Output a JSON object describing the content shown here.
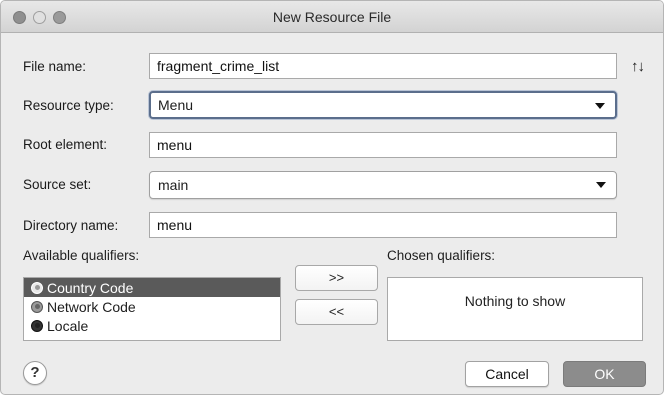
{
  "window": {
    "title": "New Resource File",
    "traffic_lights": [
      "close",
      "minimize",
      "zoom"
    ]
  },
  "form": {
    "file_name": {
      "label": "File name:",
      "value": "fragment_crime_list"
    },
    "sort_icon": "↑↓",
    "resource_type": {
      "label": "Resource type:",
      "value": "Menu"
    },
    "root_element": {
      "label": "Root element:",
      "value": "menu"
    },
    "source_set": {
      "label": "Source set:",
      "value": "main"
    },
    "directory_name": {
      "label": "Directory name:",
      "value": "menu"
    }
  },
  "qualifiers": {
    "available_label": "Available qualifiers:",
    "chosen_label": "Chosen qualifiers:",
    "available": [
      {
        "label": "Country Code",
        "icon": "country-code-icon",
        "selected": true
      },
      {
        "label": "Network Code",
        "icon": "network-code-icon",
        "selected": false
      },
      {
        "label": "Locale",
        "icon": "locale-icon",
        "selected": false
      }
    ],
    "add_button": ">>",
    "remove_button": "<<",
    "chosen_empty_text": "Nothing to show"
  },
  "footer": {
    "help": "?",
    "cancel": "Cancel",
    "ok": "OK"
  }
}
